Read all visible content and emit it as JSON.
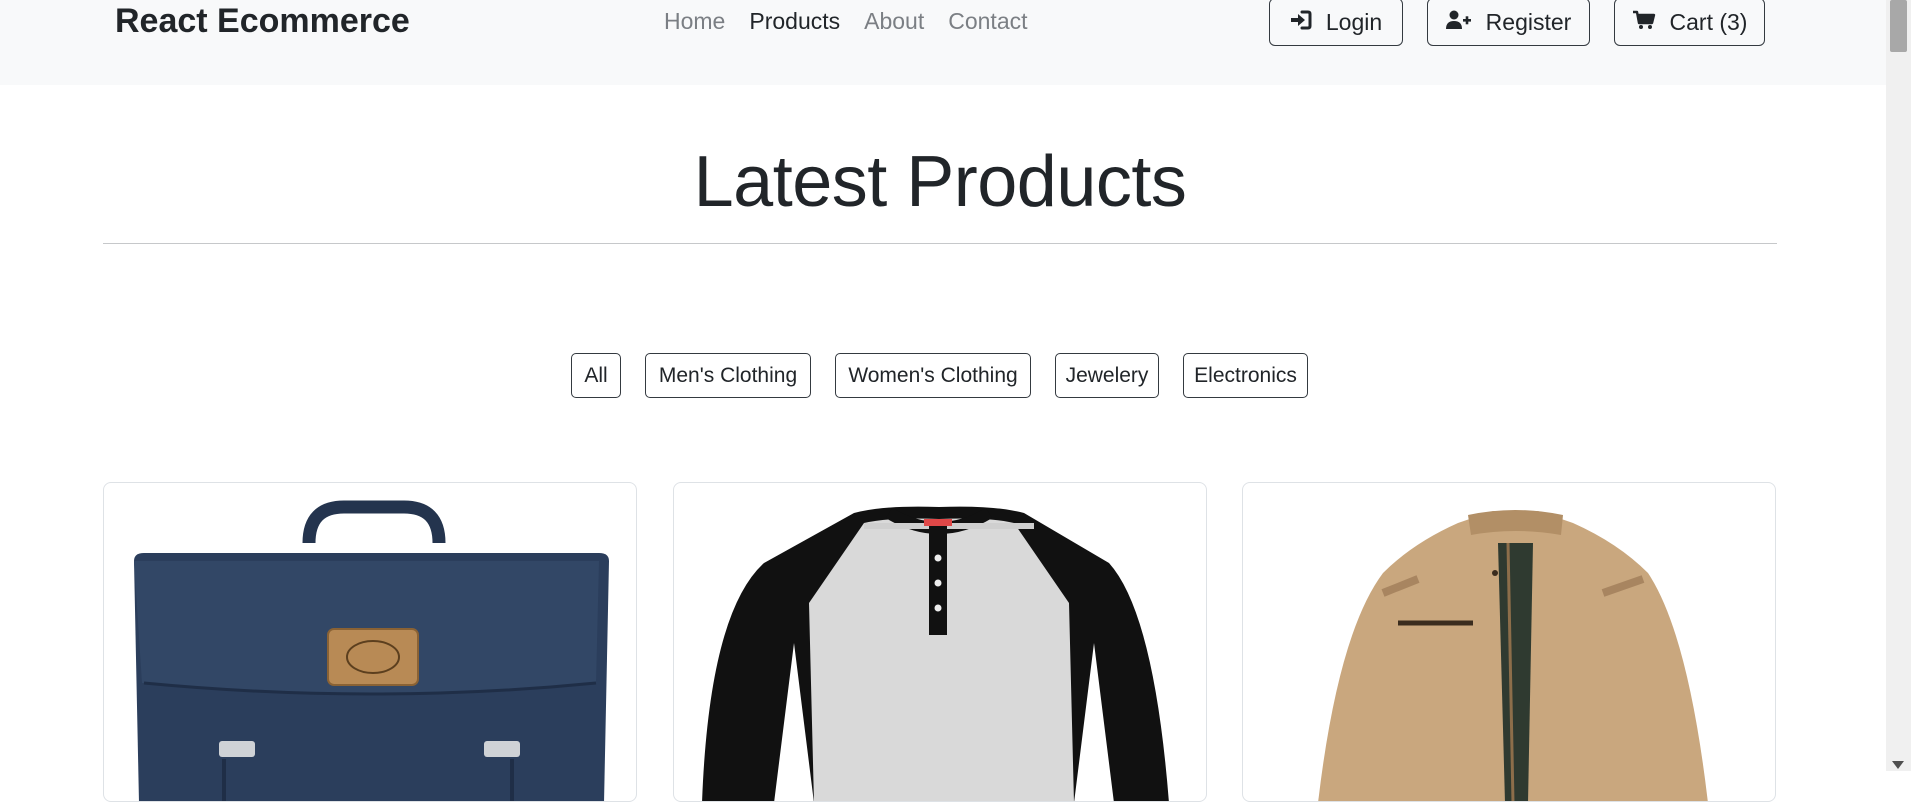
{
  "navbar": {
    "brand": "React Ecommerce",
    "links": [
      {
        "label": "Home",
        "active": false
      },
      {
        "label": "Products",
        "active": true
      },
      {
        "label": "About",
        "active": false
      },
      {
        "label": "Contact",
        "active": false
      }
    ],
    "buttons": {
      "login": {
        "label": "Login",
        "icon": "sign-in-icon"
      },
      "register": {
        "label": "Register",
        "icon": "user-plus-icon"
      },
      "cart": {
        "label": "Cart (3)",
        "icon": "shopping-cart-icon"
      }
    }
  },
  "main": {
    "title": "Latest Products",
    "filters": [
      "All",
      "Men's Clothing",
      "Women's Clothing",
      "Jewelery",
      "Electronics"
    ]
  },
  "products": [
    {
      "image": "navy-backpack-image"
    },
    {
      "image": "raglan-henley-tshirt-image"
    },
    {
      "image": "khaki-jacket-image"
    }
  ],
  "colors": {
    "navbar_bg": "#f8f9fa",
    "text": "#212529",
    "muted_link": "#7b7f84",
    "border_dark": "#343a40"
  }
}
